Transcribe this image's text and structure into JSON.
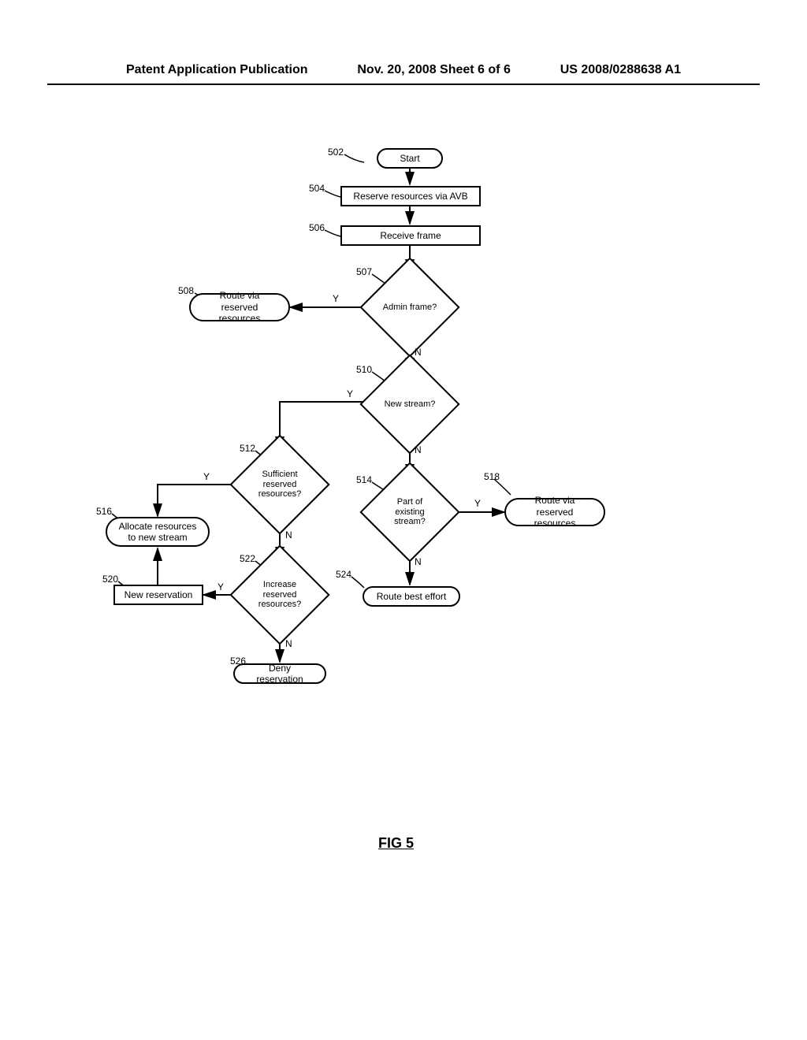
{
  "header": {
    "left": "Patent Application Publication",
    "center": "Nov. 20, 2008  Sheet 6 of 6",
    "right": "US 2008/0288638 A1"
  },
  "refs": {
    "r502": "502",
    "r504": "504",
    "r506": "506",
    "r507": "507",
    "r508": "508",
    "r510": "510",
    "r512": "512",
    "r514": "514",
    "r516": "516",
    "r518": "518",
    "r520": "520",
    "r522": "522",
    "r524": "524",
    "r526": "526"
  },
  "nodes": {
    "start": "Start",
    "reserve": "Reserve resources via AVB",
    "receive": "Receive frame",
    "admin": "Admin frame?",
    "route_reserved_508": "Route via reserved\nresources",
    "newstream": "New stream?",
    "sufficient": "Sufficient\nreserved\nresources?",
    "partexisting": "Part of existing\nstream?",
    "route_reserved_518": "Route via reserved\nresources",
    "allocate": "Allocate resources\nto new stream",
    "newres": "New reservation",
    "increase": "Increase\nreserved\nresources?",
    "route_best": "Route best effort",
    "deny": "Deny reservation"
  },
  "labels": {
    "Y": "Y",
    "N": "N"
  },
  "figure": "FIG 5",
  "chart_data": {
    "type": "flowchart",
    "title": "FIG 5",
    "nodes": [
      {
        "id": "502",
        "type": "terminator",
        "text": "Start"
      },
      {
        "id": "504",
        "type": "process",
        "text": "Reserve resources via AVB"
      },
      {
        "id": "506",
        "type": "process",
        "text": "Receive frame"
      },
      {
        "id": "507",
        "type": "decision",
        "text": "Admin frame?"
      },
      {
        "id": "508",
        "type": "terminator",
        "text": "Route via reserved resources"
      },
      {
        "id": "510",
        "type": "decision",
        "text": "New stream?"
      },
      {
        "id": "512",
        "type": "decision",
        "text": "Sufficient reserved resources?"
      },
      {
        "id": "514",
        "type": "decision",
        "text": "Part of existing stream?"
      },
      {
        "id": "516",
        "type": "terminator",
        "text": "Allocate resources to new stream"
      },
      {
        "id": "518",
        "type": "terminator",
        "text": "Route via reserved resources"
      },
      {
        "id": "520",
        "type": "process",
        "text": "New reservation"
      },
      {
        "id": "522",
        "type": "decision",
        "text": "Increase reserved resources?"
      },
      {
        "id": "524",
        "type": "terminator",
        "text": "Route best effort"
      },
      {
        "id": "526",
        "type": "terminator",
        "text": "Deny reservation"
      }
    ],
    "edges": [
      {
        "from": "502",
        "to": "504"
      },
      {
        "from": "504",
        "to": "506"
      },
      {
        "from": "506",
        "to": "507"
      },
      {
        "from": "507",
        "to": "508",
        "label": "Y"
      },
      {
        "from": "507",
        "to": "510",
        "label": "N"
      },
      {
        "from": "510",
        "to": "512",
        "label": "Y"
      },
      {
        "from": "510",
        "to": "514",
        "label": "N"
      },
      {
        "from": "512",
        "to": "516",
        "label": "Y"
      },
      {
        "from": "512",
        "to": "522",
        "label": "N"
      },
      {
        "from": "514",
        "to": "518",
        "label": "Y"
      },
      {
        "from": "514",
        "to": "524",
        "label": "N"
      },
      {
        "from": "522",
        "to": "520",
        "label": "Y"
      },
      {
        "from": "522",
        "to": "526",
        "label": "N"
      },
      {
        "from": "520",
        "to": "516"
      }
    ]
  }
}
